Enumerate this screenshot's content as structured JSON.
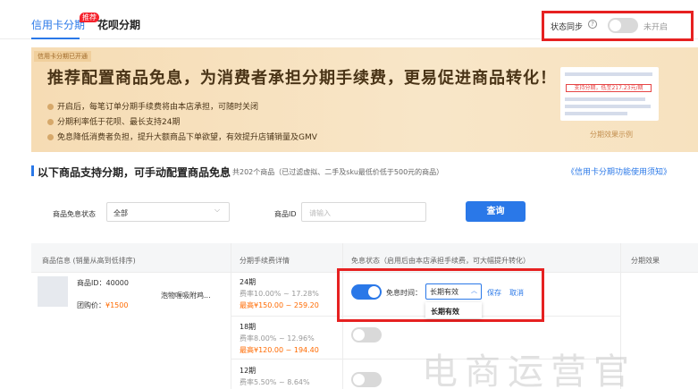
{
  "tabs": {
    "active": "信用卡分期",
    "badge": "推荐",
    "other": "花呗分期"
  },
  "sync": {
    "label": "状态同步",
    "help": "?",
    "state": "未开启"
  },
  "banner": {
    "tag": "信用卡分期已开通",
    "title": "推荐配置商品免息，为消费者承担分期手续费，更易促进商品转化！",
    "bullets": [
      "开启后，每笔订单分期手续费将由本店承担，可随时关闭",
      "分期利率低于花呗、最长支持24期",
      "免息降低消费者负担，提升大额商品下单欲望，有效提升店铺销量及GMV"
    ],
    "sample_text": "支持分期，低至217.23元/期",
    "sample_caption": "分期效果示例"
  },
  "section": {
    "title": "以下商品支持分期，可手动配置商品免息",
    "subtitle": "共202个商品（已过滤虚拟、二手及sku最低价低于500元的商品）",
    "link": "《信用卡分期功能使用须知》"
  },
  "filter": {
    "status_label": "商品免息状态",
    "status_value": "全部",
    "id_label": "商品ID",
    "id_placeholder": "请输入",
    "query_button": "查询"
  },
  "table": {
    "headers": [
      "商品信息 (销量从高到低排序)",
      "分期手续费详情",
      "免息状态（启用后由本店承担手续费，可大幅提升转化）",
      "分期效果"
    ],
    "product": {
      "id_label": "商品ID：40000",
      "name_suffix": "泡物喱吸附鸡...",
      "group_price_label": "团购价：",
      "group_price": "¥1500"
    },
    "periods": [
      {
        "name": "24期",
        "rate": "费率10.00% ~ 17.28%",
        "max": "最高¥150.00 ~ 259.20"
      },
      {
        "name": "18期",
        "rate": "费率8.00% ~ 12.96%",
        "max": "最高¥120.00 ~ 194.40"
      },
      {
        "name": "12期",
        "rate": "费率5.50% ~ 8.64%",
        "max": ""
      }
    ],
    "free_time_label": "免息时间：",
    "free_time_value": "长期有效",
    "save": "保存",
    "cancel": "取消",
    "dropdown_option": "长期有效"
  },
  "watermark": "电商运营官"
}
